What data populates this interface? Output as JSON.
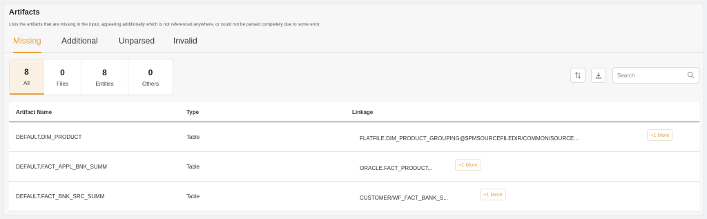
{
  "header": {
    "title": "Artifacts",
    "subtitle": "Lists the artifacts that are missing in the input, appearing additionally which is not referenced anywhere, or could not be parsed completely due to some error."
  },
  "tabs": [
    {
      "label": "Missing",
      "active": true
    },
    {
      "label": "Additional",
      "active": false
    },
    {
      "label": "Unparsed",
      "active": false
    },
    {
      "label": "Invalid",
      "active": false
    }
  ],
  "counts": [
    {
      "value": "8",
      "label": "All",
      "active": true
    },
    {
      "value": "0",
      "label": "Files",
      "active": false
    },
    {
      "value": "8",
      "label": "Entities",
      "active": false
    },
    {
      "value": "0",
      "label": "Others",
      "active": false
    }
  ],
  "toolbar": {
    "sort_icon": "sort-icon",
    "download_icon": "download-icon",
    "search_placeholder": "Search",
    "search_value": ""
  },
  "table": {
    "columns": [
      "Artifact Name",
      "Type",
      "Linkage"
    ],
    "rows": [
      {
        "name": "DEFAULT.DIM_PRODUCT",
        "type": "Table",
        "linkage": "FLATFILE.DIM_PRODUCT_GROUPING@$PMSOURCEFILEDIR/COMMON/SOURCE...",
        "more": "+1 More"
      },
      {
        "name": "DEFAULT.FACT_APPL_BNK_SUMM",
        "type": "Table",
        "linkage": "ORACLE.FACT_PRODUCT...",
        "more": "+1 More"
      },
      {
        "name": "DEFAULT.FACT_BNK_SRC_SUMM",
        "type": "Table",
        "linkage": "CUSTOMER/WF_FACT_BANK_S...",
        "more": "+1 More"
      }
    ]
  },
  "colors": {
    "accent": "#e8a23a",
    "background": "#f7f7f8"
  }
}
